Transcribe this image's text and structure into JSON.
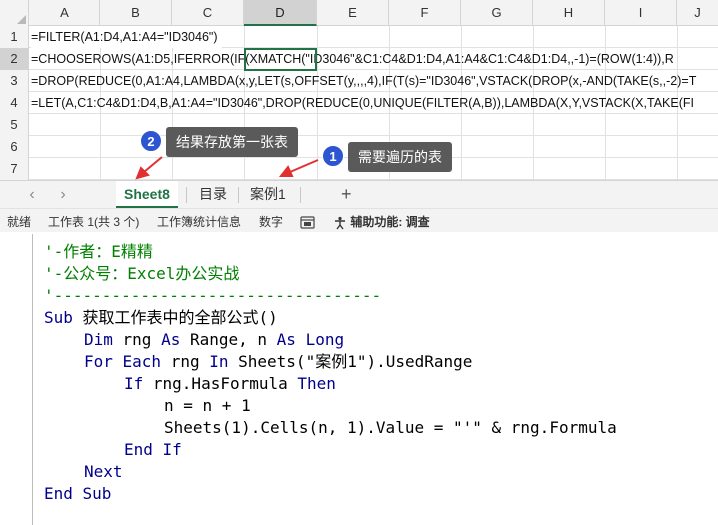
{
  "excel": {
    "columns": [
      "A",
      "B",
      "C",
      "D",
      "E",
      "F",
      "G",
      "H",
      "I",
      "J"
    ],
    "selected_column": "D",
    "rows": [
      {
        "num": "1",
        "formula": "=FILTER(A1:D4,A1:A4=\"ID3046\")"
      },
      {
        "num": "2",
        "formula": "=CHOOSEROWS(A1:D5,IFERROR(IF(XMATCH(\"ID3046\"&C1:C4&D1:D4,A1:A4&C1:C4&D1:D4,,-1)=(ROW(1:4)),R"
      },
      {
        "num": "3",
        "formula": "=DROP(REDUCE(0,A1:A4,LAMBDA(x,y,LET(s,OFFSET(y,,,,4),IF(T(s)=\"ID3046\",VSTACK(DROP(x,-AND(TAKE(s,,-2)=T"
      },
      {
        "num": "4",
        "formula": "=LET(A,C1:C4&D1:D4,B,A1:A4=\"ID3046\",DROP(REDUCE(0,UNIQUE(FILTER(A,B)),LAMBDA(X,Y,VSTACK(X,TAKE(FI"
      },
      {
        "num": "5",
        "formula": ""
      },
      {
        "num": "6",
        "formula": ""
      },
      {
        "num": "7",
        "formula": ""
      }
    ]
  },
  "callouts": [
    {
      "badge": "2",
      "text": "结果存放第一张表"
    },
    {
      "badge": "1",
      "text": "需要遍历的表"
    }
  ],
  "tabs": {
    "prev_icon": "‹",
    "next_icon": "›",
    "items": [
      "Sheet8",
      "目录",
      "案例1"
    ],
    "active_index": 0,
    "add_icon": "+"
  },
  "status": {
    "ready": "就绪",
    "sheet_info": "工作表 1(共 3 个)",
    "workbook_stats": "工作簿统计信息",
    "numbers": "数字",
    "accessibility": "辅助功能: 调查"
  },
  "vba": {
    "lines": [
      {
        "indent": 0,
        "parts": [
          {
            "t": "'-作者：E精精",
            "c": "cm"
          }
        ]
      },
      {
        "indent": 0,
        "parts": [
          {
            "t": "'-公众号：Excel办公实战",
            "c": "cm"
          }
        ]
      },
      {
        "indent": 0,
        "parts": [
          {
            "t": "'----------------------------------",
            "c": "cm"
          }
        ]
      },
      {
        "indent": 0,
        "parts": [
          {
            "t": "Sub",
            "c": "kw"
          },
          {
            "t": " 获取工作表中的全部公式()",
            "c": ""
          }
        ]
      },
      {
        "indent": 1,
        "parts": [
          {
            "t": "Dim",
            "c": "kw"
          },
          {
            "t": " rng ",
            "c": ""
          },
          {
            "t": "As",
            "c": "kw"
          },
          {
            "t": " Range, n ",
            "c": ""
          },
          {
            "t": "As",
            "c": "kw"
          },
          {
            "t": " ",
            "c": ""
          },
          {
            "t": "Long",
            "c": "kw"
          }
        ]
      },
      {
        "indent": 1,
        "parts": [
          {
            "t": "For Each",
            "c": "kw"
          },
          {
            "t": " rng ",
            "c": ""
          },
          {
            "t": "In",
            "c": "kw"
          },
          {
            "t": " Sheets(\"案例1\").UsedRange",
            "c": ""
          }
        ]
      },
      {
        "indent": 2,
        "parts": [
          {
            "t": "If",
            "c": "kw"
          },
          {
            "t": " rng.HasFormula ",
            "c": ""
          },
          {
            "t": "Then",
            "c": "kw"
          }
        ]
      },
      {
        "indent": 3,
        "parts": [
          {
            "t": "n = n + 1",
            "c": ""
          }
        ]
      },
      {
        "indent": 3,
        "parts": [
          {
            "t": "Sheets(1).Cells(n, 1).Value = \"'\" & rng.Formula",
            "c": ""
          }
        ]
      },
      {
        "indent": 2,
        "parts": [
          {
            "t": "End If",
            "c": "kw"
          }
        ]
      },
      {
        "indent": 1,
        "parts": [
          {
            "t": "Next",
            "c": "kw"
          }
        ]
      },
      {
        "indent": 0,
        "parts": [
          {
            "t": "End Sub",
            "c": "kw"
          }
        ]
      }
    ]
  },
  "colors": {
    "excel_green": "#217346",
    "callout_bg": "#5a5a5a",
    "badge_blue": "#2d55d2",
    "arrow_red": "#e23030",
    "comment_green": "#008000",
    "keyword_navy": "#00008b"
  }
}
